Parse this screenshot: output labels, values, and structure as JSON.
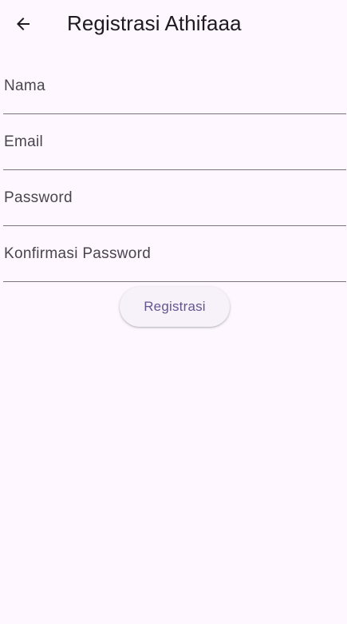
{
  "app_bar": {
    "title": "Registrasi Athifaaa",
    "back_icon": "arrow-left-icon"
  },
  "form": {
    "fields": [
      {
        "label": "Nama",
        "value": ""
      },
      {
        "label": "Email",
        "value": ""
      },
      {
        "label": "Password",
        "value": ""
      },
      {
        "label": "Konfirmasi Password",
        "value": ""
      }
    ],
    "submit_label": "Registrasi"
  },
  "colors": {
    "background": "#fef7ff",
    "title_text": "#1d1b20",
    "label_text": "#49454f",
    "underline": "#79747e",
    "button_background": "#f7f2fa",
    "button_text": "#65558f"
  }
}
